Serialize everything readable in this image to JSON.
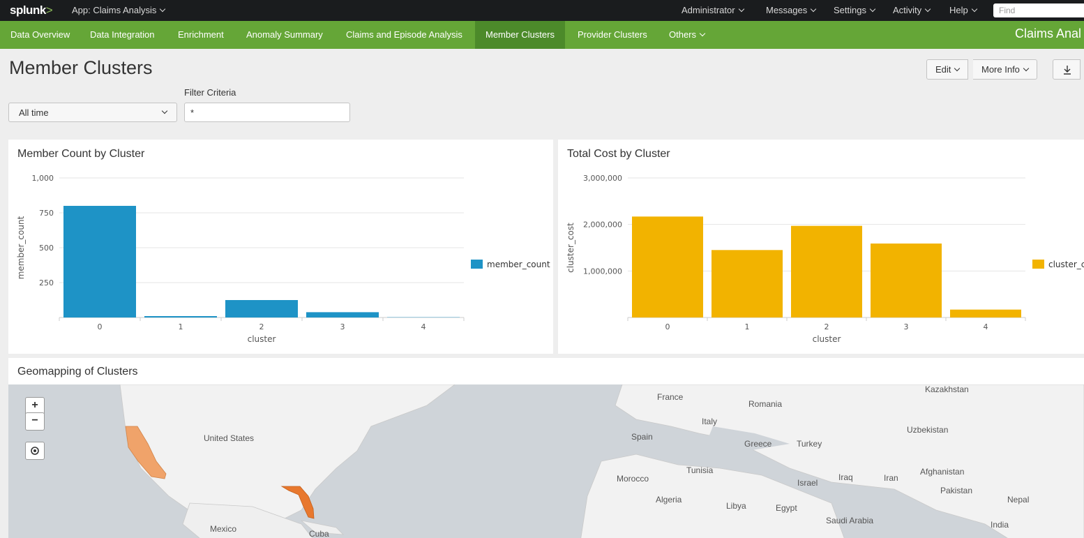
{
  "topbar": {
    "logo": "splunk",
    "logo_mark": ">",
    "app_label": "App: Claims Analysis",
    "menus": [
      "Administrator",
      "Messages",
      "Settings",
      "Activity",
      "Help"
    ],
    "find_placeholder": "Find"
  },
  "nav": {
    "items": [
      "Data Overview",
      "Data Integration",
      "Enrichment",
      "Anomaly Summary",
      "Claims and Episode Analysis",
      "Member Clusters",
      "Provider Clusters",
      "Others"
    ],
    "active": "Member Clusters",
    "brand": "Claims Anal"
  },
  "page": {
    "title": "Member Clusters",
    "edit_label": "Edit",
    "more_info_label": "More Info"
  },
  "inputs": {
    "time_range": "All time",
    "filter_label": "Filter Criteria",
    "filter_value": "*"
  },
  "panels": {
    "member_count_title": "Member Count by Cluster",
    "total_cost_title": "Total Cost by Cluster",
    "geomap_title": "Geomapping of Clusters"
  },
  "chart_data": [
    {
      "type": "bar",
      "title": "Member Count by Cluster",
      "categories": [
        "0",
        "1",
        "2",
        "3",
        "4"
      ],
      "series": [
        {
          "name": "member_count",
          "values": [
            800,
            10,
            125,
            38,
            2
          ]
        }
      ],
      "xlabel": "cluster",
      "ylabel": "member_count",
      "ylim": [
        0,
        1000
      ],
      "yticks": [
        250,
        500,
        750,
        1000
      ],
      "ytick_labels": [
        "250",
        "500",
        "750",
        "1,000"
      ],
      "color": "#1e93c6",
      "legend": "right",
      "grid": true
    },
    {
      "type": "bar",
      "title": "Total Cost by Cluster",
      "categories": [
        "0",
        "1",
        "2",
        "3",
        "4"
      ],
      "series": [
        {
          "name": "cluster_c",
          "values": [
            2170000,
            1450000,
            1970000,
            1590000,
            170000
          ]
        }
      ],
      "xlabel": "cluster",
      "ylabel": "cluster_cost",
      "ylim": [
        0,
        3000000
      ],
      "yticks": [
        1000000,
        2000000,
        3000000
      ],
      "ytick_labels": [
        "1,000,000",
        "2,000,000",
        "3,000,000"
      ],
      "color": "#f2b300",
      "legend": "right",
      "grid": true
    }
  ],
  "map": {
    "labels": [
      "United States",
      "Mexico",
      "Cuba",
      "France",
      "Romania",
      "Italy",
      "Spain",
      "Greece",
      "Turkey",
      "Tunisia",
      "Morocco",
      "Algeria",
      "Libya",
      "Egypt",
      "Israel",
      "Iraq",
      "Iran",
      "Saudi Arabia",
      "Kazakhstan",
      "Uzbekistan",
      "Afghanistan",
      "Pakistan",
      "Nepal",
      "India"
    ],
    "highlight_colors": {
      "california": "#f0a36a",
      "florida": "#e8782e"
    }
  }
}
